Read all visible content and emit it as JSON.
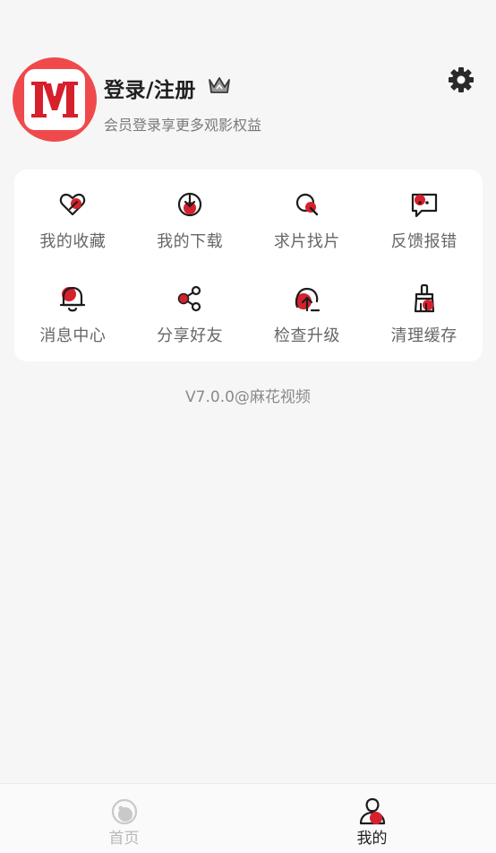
{
  "profile": {
    "title": "登录/注册",
    "subtitle": "会员登录享更多观影权益",
    "avatar_icon": "app-logo-icon",
    "crown_icon": "crown-icon",
    "settings_icon": "gear-icon"
  },
  "menu": {
    "items": [
      {
        "label": "我的收藏",
        "icon": "heart-icon"
      },
      {
        "label": "我的下载",
        "icon": "download-icon"
      },
      {
        "label": "求片找片",
        "icon": "search-icon"
      },
      {
        "label": "反馈报错",
        "icon": "feedback-icon"
      },
      {
        "label": "消息中心",
        "icon": "bell-icon"
      },
      {
        "label": "分享好友",
        "icon": "share-icon"
      },
      {
        "label": "检查升级",
        "icon": "upgrade-icon"
      },
      {
        "label": "清理缓存",
        "icon": "broom-icon"
      }
    ]
  },
  "version": "V7.0.0@麻花视频",
  "tabbar": {
    "tabs": [
      {
        "label": "首页",
        "icon": "home-icon",
        "active": false
      },
      {
        "label": "我的",
        "icon": "user-icon",
        "active": true
      }
    ]
  },
  "colors": {
    "accent": "#d6202c",
    "avatar_bg": "#f0494c",
    "page_bg": "#f6f6f6",
    "card_bg": "#ffffff",
    "label_gray": "#666666"
  }
}
